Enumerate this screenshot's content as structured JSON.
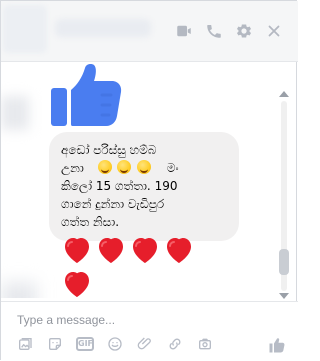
{
  "header": {
    "icons": [
      "video-call-icon",
      "phone-icon",
      "gear-icon",
      "close-icon"
    ]
  },
  "messages": {
    "sticker": "blue-thumbs-up",
    "bubble_text": {
      "line1": "අඩෝ පරිස්සු හම්බ",
      "line2": "උනා",
      "line3": "මං",
      "line4": "කිලෝ 15 ගත්තා. 190",
      "line5": "ගානේ දුන්නා වැඩිපුර",
      "line6": "ගත්ත නිසා."
    },
    "emoji_count": 3,
    "hearts_count": 5
  },
  "composer": {
    "placeholder": "Type a message...",
    "tools": [
      "photo-icon",
      "sticker-icon",
      "gif-icon",
      "emoji-icon",
      "attachment-icon",
      "link-icon",
      "camera-icon"
    ],
    "like_icon": "like-icon"
  },
  "colors": {
    "accent_blue": "#4a7df0",
    "heart_red": "#e61e2b",
    "bubble_bg": "#f1f0f0",
    "icon_gray": "#b7bcc6"
  }
}
